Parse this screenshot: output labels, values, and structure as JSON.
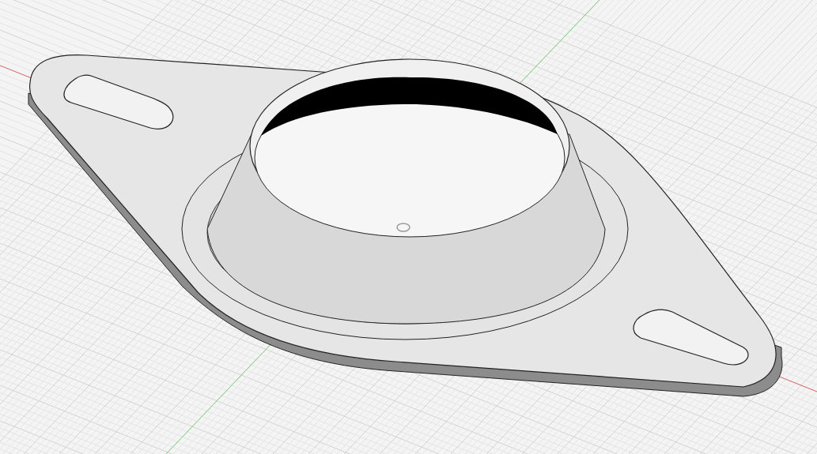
{
  "viewport": {
    "grid": true,
    "axes": true,
    "origin_marker": true
  }
}
